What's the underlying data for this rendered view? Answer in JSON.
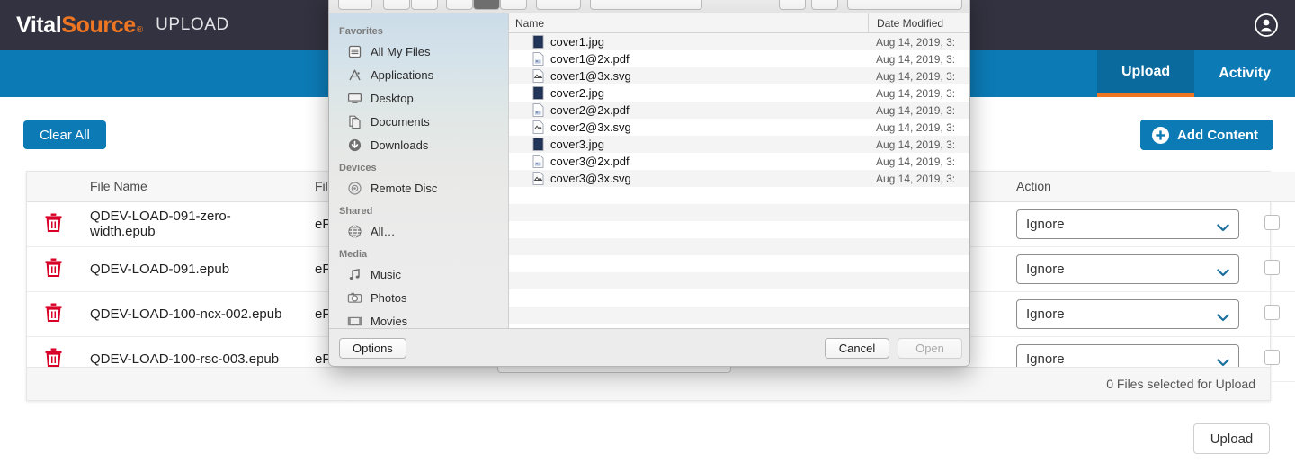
{
  "header": {
    "logo_primary": "Vital",
    "logo_secondary": "Source",
    "logo_registered": "®",
    "app_title": "UPLOAD",
    "account_icon": "account-circle-icon"
  },
  "nav": {
    "tabs": [
      {
        "label": "Upload",
        "active": true
      },
      {
        "label": "Activity",
        "active": false
      }
    ]
  },
  "toolbar": {
    "clear_all_label": "Clear All",
    "add_content_label": "Add Content",
    "add_content_icon": "plus-circle-icon"
  },
  "file_table": {
    "columns": [
      "",
      "File Name",
      "File T",
      "",
      "Action",
      ""
    ],
    "rows": [
      {
        "delete_icon": "trash-icon",
        "file_name": "QDEV-LOAD-091-zero-width.epub",
        "file_type": "ePub",
        "action": "Ignore",
        "checked": false
      },
      {
        "delete_icon": "trash-icon",
        "file_name": "QDEV-LOAD-091.epub",
        "file_type": "ePub",
        "action": "Ignore",
        "checked": false
      },
      {
        "delete_icon": "trash-icon",
        "file_name": "QDEV-LOAD-100-ncx-002.epub",
        "file_type": "ePub",
        "action": "Ignore",
        "checked": false
      },
      {
        "delete_icon": "trash-icon",
        "file_name": "QDEV-LOAD-100-rsc-003.epub",
        "file_type": "ePub",
        "action": "Ignore",
        "checked": false
      }
    ],
    "footer_status": "0 Files selected for Upload"
  },
  "upload_button": {
    "label": "Upload"
  },
  "file_dialog": {
    "sidebar": {
      "groups": [
        {
          "title": "Favorites",
          "items": [
            {
              "label": "All My Files",
              "icon": "all-my-files-icon"
            },
            {
              "label": "Applications",
              "icon": "applications-icon"
            },
            {
              "label": "Desktop",
              "icon": "desktop-icon"
            },
            {
              "label": "Documents",
              "icon": "documents-icon"
            },
            {
              "label": "Downloads",
              "icon": "downloads-icon"
            }
          ]
        },
        {
          "title": "Devices",
          "items": [
            {
              "label": "Remote Disc",
              "icon": "remote-disc-icon"
            }
          ]
        },
        {
          "title": "Shared",
          "items": [
            {
              "label": "All…",
              "icon": "network-globe-icon"
            }
          ]
        },
        {
          "title": "Media",
          "items": [
            {
              "label": "Music",
              "icon": "music-note-icon"
            },
            {
              "label": "Photos",
              "icon": "camera-icon"
            },
            {
              "label": "Movies",
              "icon": "film-icon"
            }
          ]
        }
      ]
    },
    "list": {
      "columns": {
        "name": "Name",
        "date_modified": "Date Modified"
      },
      "files": [
        {
          "name": "cover1.jpg",
          "date_modified": "Aug 14, 2019, 3:",
          "icon": "jpg-file-icon"
        },
        {
          "name": "cover1@2x.pdf",
          "date_modified": "Aug 14, 2019, 3:",
          "icon": "pdf-file-icon"
        },
        {
          "name": "cover1@3x.svg",
          "date_modified": "Aug 14, 2019, 3:",
          "icon": "svg-file-icon"
        },
        {
          "name": "cover2.jpg",
          "date_modified": "Aug 14, 2019, 3:",
          "icon": "jpg-file-icon"
        },
        {
          "name": "cover2@2x.pdf",
          "date_modified": "Aug 14, 2019, 3:",
          "icon": "pdf-file-icon"
        },
        {
          "name": "cover2@3x.svg",
          "date_modified": "Aug 14, 2019, 3:",
          "icon": "svg-file-icon"
        },
        {
          "name": "cover3.jpg",
          "date_modified": "Aug 14, 2019, 3:",
          "icon": "jpg-file-icon"
        },
        {
          "name": "cover3@2x.pdf",
          "date_modified": "Aug 14, 2019, 3:",
          "icon": "pdf-file-icon"
        },
        {
          "name": "cover3@3x.svg",
          "date_modified": "Aug 14, 2019, 3:",
          "icon": "svg-file-icon"
        }
      ]
    },
    "buttons": {
      "options": "Options",
      "cancel": "Cancel",
      "open": "Open"
    }
  },
  "colors": {
    "header_bg": "#323240",
    "nav_bg": "#0c7ab5",
    "nav_active_bg": "#0a6a9e",
    "accent_orange": "#ee7623",
    "primary_blue": "#0c7ab5",
    "trash_red": "#d80027"
  }
}
